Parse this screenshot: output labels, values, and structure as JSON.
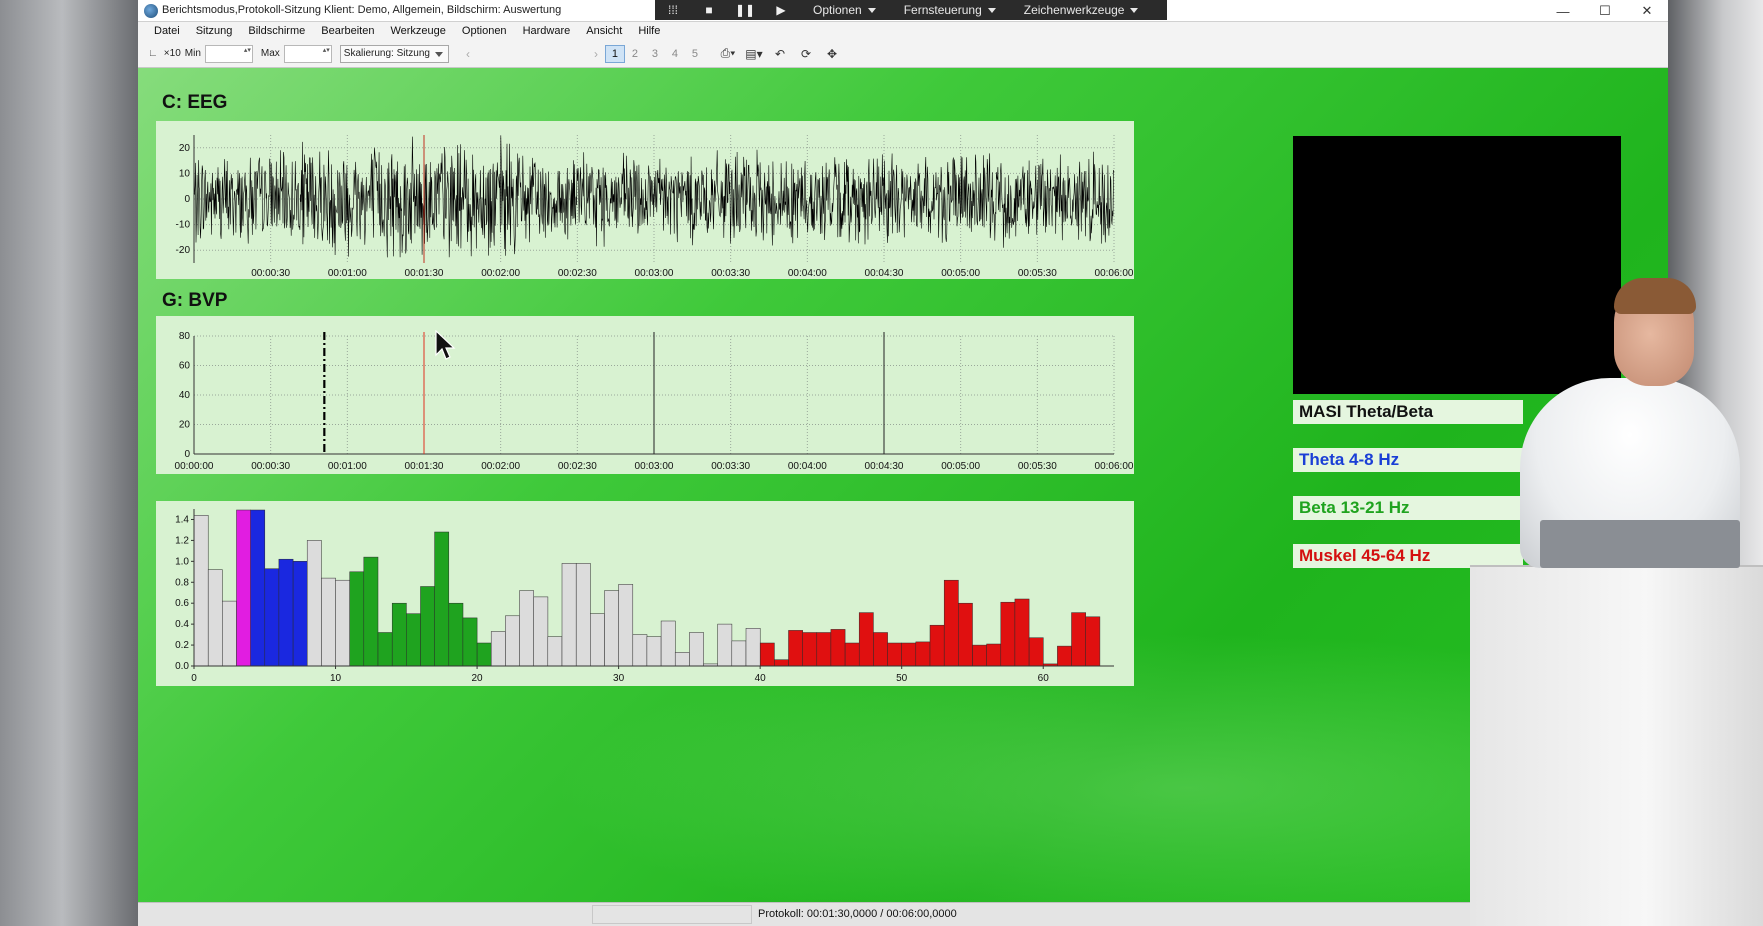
{
  "window": {
    "title": "Berichtsmodus,Protokoll-Sitzung Klient: Demo, Allgemein, Bildschirm: Auswertung",
    "minimize": "—",
    "maximize": "☐",
    "close": "✕"
  },
  "remote_toolbar": {
    "menus": [
      "Optionen",
      "Fernsteuerung",
      "Zeichenwerkzeuge"
    ]
  },
  "menubar": {
    "items": [
      "Datei",
      "Sitzung",
      "Bildschirme",
      "Bearbeiten",
      "Werkzeuge",
      "Optionen",
      "Hardware",
      "Ansicht",
      "Hilfe"
    ]
  },
  "toolbar": {
    "zoom_label": "×10",
    "min_label": "Min",
    "max_label": "Max",
    "scaling": "Skalierung: Sitzung",
    "pages": [
      "1",
      "2",
      "3",
      "4",
      "5"
    ],
    "active_page": "1"
  },
  "eeg": {
    "title": "C: EEG",
    "ylim": [
      -25,
      25
    ],
    "yticks": [
      "20",
      "10",
      "0",
      "-10",
      "-20"
    ],
    "xticks": [
      "00:00:30",
      "00:01:00",
      "00:01:30",
      "00:02:00",
      "00:02:30",
      "00:03:00",
      "00:03:30",
      "00:04:00",
      "00:04:30",
      "00:05:00",
      "00:05:30",
      "00:06:00"
    ],
    "duration_s": 360,
    "cursor_s": 90
  },
  "bvp": {
    "title": "G: BVP",
    "ylim": [
      0,
      80
    ],
    "yticks": [
      "80",
      "60",
      "40",
      "20",
      "0"
    ],
    "xticks": [
      "00:00:00",
      "00:00:30",
      "00:01:00",
      "00:01:30",
      "00:02:00",
      "00:02:30",
      "00:03:00",
      "00:03:30",
      "00:04:00",
      "00:04:30",
      "00:05:00",
      "00:05:30",
      "00:06:00"
    ],
    "duration_s": 360,
    "markers": [
      {
        "t": 51,
        "style": "dashdot",
        "color": "#000000"
      },
      {
        "t": 90,
        "style": "solid",
        "color": "#e0301e"
      },
      {
        "t": 180,
        "style": "solid",
        "color": "#222222"
      },
      {
        "t": 270,
        "style": "solid",
        "color": "#222222"
      }
    ]
  },
  "chart_data": {
    "type": "bar",
    "xlim": [
      0,
      65
    ],
    "ylim": [
      0,
      1.5
    ],
    "xticks": [
      "0",
      "10",
      "20",
      "30",
      "40",
      "50",
      "60"
    ],
    "yticks": [
      "1.4",
      "1.2",
      "1.0",
      "0.8",
      "0.6",
      "0.4",
      "0.2",
      "0.0"
    ],
    "bins": [
      0,
      1,
      2,
      3,
      4,
      5,
      6,
      7,
      8,
      9,
      10,
      11,
      12,
      13,
      14,
      15,
      16,
      17,
      18,
      19,
      20,
      21,
      22,
      23,
      24,
      25,
      26,
      27,
      28,
      29,
      30,
      31,
      32,
      33,
      34,
      35,
      36,
      37,
      38,
      39,
      40,
      41,
      42,
      43,
      44,
      45,
      46,
      47,
      48,
      49,
      50,
      51,
      52,
      53,
      54,
      55,
      56,
      57,
      58,
      59,
      60,
      61,
      62,
      63
    ],
    "values": [
      1.44,
      0.92,
      0.62,
      1.49,
      1.49,
      0.93,
      1.02,
      1.0,
      1.2,
      0.84,
      0.82,
      0.9,
      1.04,
      0.32,
      0.6,
      0.5,
      0.76,
      1.28,
      0.6,
      0.46,
      0.22,
      0.33,
      0.48,
      0.72,
      0.66,
      0.28,
      0.98,
      0.98,
      0.5,
      0.72,
      0.78,
      0.3,
      0.28,
      0.43,
      0.13,
      0.32,
      0.02,
      0.4,
      0.24,
      0.36,
      0.22,
      0.06,
      0.34,
      0.32,
      0.32,
      0.35,
      0.22,
      0.51,
      0.32,
      0.22,
      0.22,
      0.23,
      0.39,
      0.82,
      0.6,
      0.2,
      0.21,
      0.61,
      0.64,
      0.27,
      0.02,
      0.19,
      0.51,
      0.47
    ],
    "colors": {
      "muted": "#dcdcdc",
      "magenta": "#e11de1",
      "blue": "#1a28e0",
      "green": "#1fa31f",
      "red": "#e01010"
    },
    "bin_colors": [
      "muted",
      "muted",
      "muted",
      "magenta",
      "blue",
      "blue",
      "blue",
      "blue",
      "muted",
      "muted",
      "muted",
      "green",
      "green",
      "green",
      "green",
      "green",
      "green",
      "green",
      "green",
      "green",
      "green",
      "muted",
      "muted",
      "muted",
      "muted",
      "muted",
      "muted",
      "muted",
      "muted",
      "muted",
      "muted",
      "muted",
      "muted",
      "muted",
      "muted",
      "muted",
      "muted",
      "muted",
      "muted",
      "muted",
      "red",
      "red",
      "red",
      "red",
      "red",
      "red",
      "red",
      "red",
      "red",
      "red",
      "red",
      "red",
      "red",
      "red",
      "red",
      "red",
      "red",
      "red",
      "red",
      "red",
      "red",
      "red",
      "red",
      "red"
    ]
  },
  "ratios": [
    {
      "label": "MASI Theta/Beta",
      "color": "#111111"
    },
    {
      "label": "Theta 4-8 Hz",
      "color": "#1a3fd6"
    },
    {
      "label": "Beta 13-21 Hz",
      "color": "#1fa31f"
    },
    {
      "label": "Muskel 45-64 Hz",
      "color": "#d41010"
    }
  ],
  "statusbar": {
    "text": "Protokoll: 00:01:30,0000 / 00:06:00,0000"
  }
}
